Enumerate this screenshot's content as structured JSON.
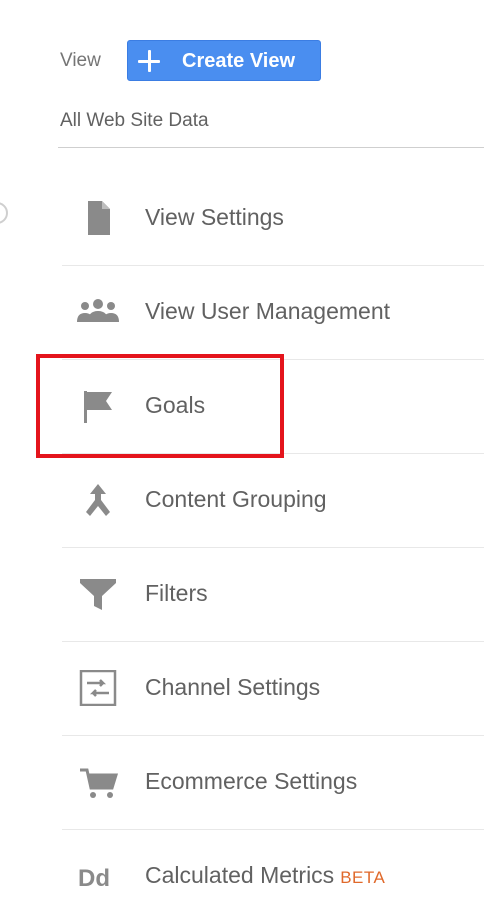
{
  "header": {
    "view_label": "View",
    "create_view_label": "Create View",
    "selected_view": "All Web Site Data"
  },
  "menu": [
    {
      "label": "View Settings",
      "icon": "document-icon"
    },
    {
      "label": "View User Management",
      "icon": "users-icon"
    },
    {
      "label": "Goals",
      "icon": "flag-icon"
    },
    {
      "label": "Content Grouping",
      "icon": "merge-icon"
    },
    {
      "label": "Filters",
      "icon": "filter-icon"
    },
    {
      "label": "Channel Settings",
      "icon": "channel-settings-icon"
    },
    {
      "label": "Ecommerce Settings",
      "icon": "cart-icon"
    },
    {
      "label": "Calculated Metrics",
      "badge": "BETA",
      "icon": "calculated-metrics-icon"
    }
  ],
  "colors": {
    "button": "#4a8ef0",
    "highlight": "#e4141c",
    "beta": "#e0692b",
    "icon": "#757575"
  }
}
